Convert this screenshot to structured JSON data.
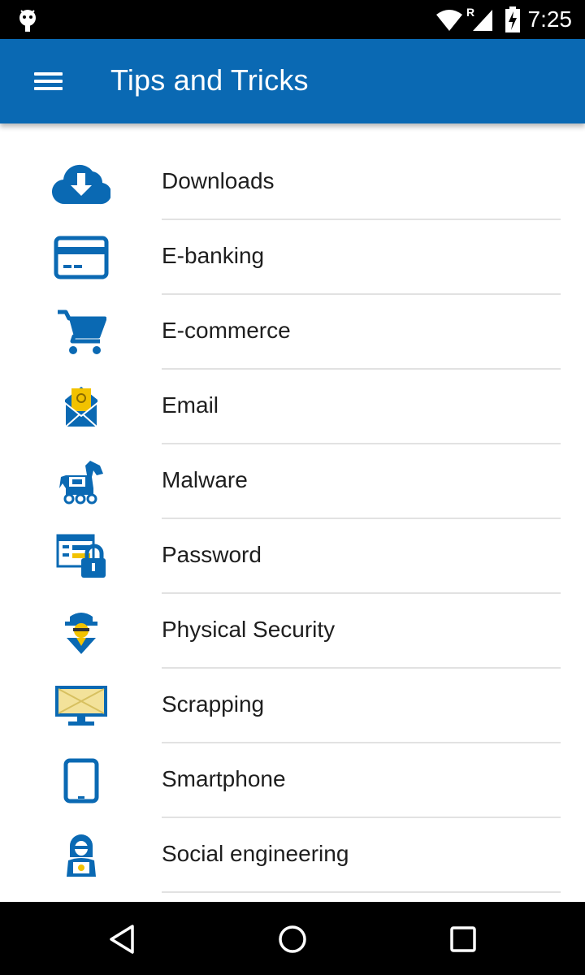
{
  "status_bar": {
    "time": "7:25",
    "roaming_indicator": "R",
    "icons": [
      "android-debug-icon",
      "wifi-icon",
      "cell-signal-icon",
      "battery-icon"
    ]
  },
  "app_bar": {
    "title": "Tips and Tricks",
    "menu_icon": "hamburger-menu-icon",
    "background_color": "#0a69b3"
  },
  "accent_color": "#0a69b3",
  "items": [
    {
      "label": "Downloads",
      "icon": "cloud-download-icon"
    },
    {
      "label": "E-banking",
      "icon": "credit-card-icon"
    },
    {
      "label": "E-commerce",
      "icon": "shopping-cart-icon"
    },
    {
      "label": "Email",
      "icon": "envelope-icon"
    },
    {
      "label": "Malware",
      "icon": "trojan-horse-icon"
    },
    {
      "label": "Password",
      "icon": "password-lock-icon"
    },
    {
      "label": "Physical Security",
      "icon": "spy-icon"
    },
    {
      "label": "Scrapping",
      "icon": "monitor-icon"
    },
    {
      "label": "Smartphone",
      "icon": "tablet-icon"
    },
    {
      "label": "Social engineering",
      "icon": "hacker-icon"
    }
  ],
  "nav_bar": {
    "buttons": [
      "back-icon",
      "home-icon",
      "recents-icon"
    ]
  }
}
